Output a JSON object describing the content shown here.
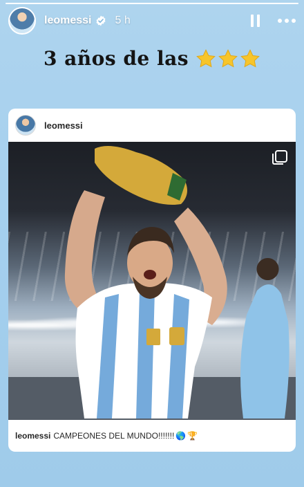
{
  "story": {
    "progress": 1.0,
    "username": "leomessi",
    "time": "5 h",
    "icons": {
      "verified": "verified-badge-icon",
      "pause": "pause-icon",
      "more": "more-icon"
    }
  },
  "caption": {
    "text": "3 años de las",
    "stars": [
      "⭐",
      "⭐",
      "⭐"
    ]
  },
  "post": {
    "username": "leomessi",
    "caption_username": "leomessi",
    "caption_text": "CAMPEONES DEL MUNDO!!!!!!!",
    "caption_emojis": [
      "🌎",
      "🏆"
    ],
    "icons": {
      "multiple_images": "carousel-icon"
    }
  },
  "colors": {
    "background": "#a9d2ed",
    "jersey_blue": "#75aadb",
    "trophy_gold": "#d4a93a",
    "star_gold": "#f7c52b"
  }
}
